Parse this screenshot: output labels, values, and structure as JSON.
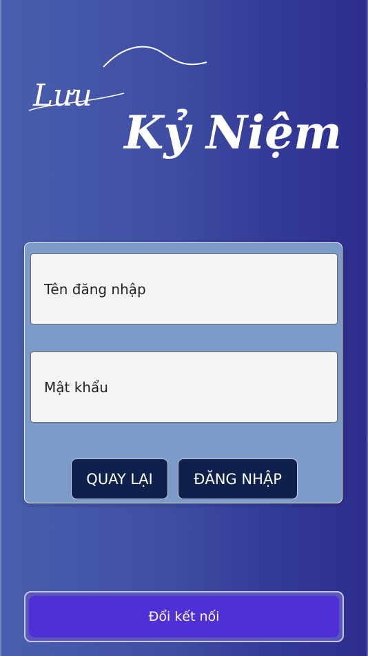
{
  "logo": {
    "line1": "Lưu",
    "line2": "Kỷ Niệm"
  },
  "login": {
    "username_placeholder": "Tên đăng nhập",
    "password_placeholder": "Mật khẩu",
    "back_label": "QUAY LẠI",
    "login_label": "ĐĂNG NHẬP"
  },
  "footer": {
    "switch_label": "Đổi kết nối"
  },
  "colors": {
    "background_left": "#4a5fae",
    "background_right": "#2d2d8e",
    "card": "#7b9bc9",
    "button": "#10204c",
    "switch_button": "#4f2fd6"
  }
}
